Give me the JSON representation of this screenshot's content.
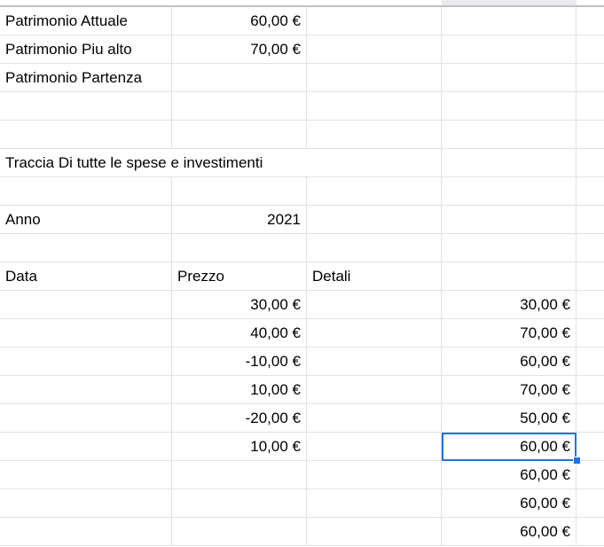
{
  "cells": {
    "patrimonio_attuale_label": "Patrimonio Attuale",
    "patrimonio_attuale_value": "60,00 €",
    "patrimonio_piu_alto_label": "Patrimonio Piu alto",
    "patrimonio_piu_alto_value": "70,00 €",
    "patrimonio_partenza_label": "Patrimonio Partenza",
    "traccia_title": "Traccia Di tutte le spese e investimenti",
    "anno_label": "Anno",
    "anno_value": "2021",
    "header_data": "Data",
    "header_prezzo": "Prezzo",
    "header_detali": "Detali"
  },
  "prezzo": [
    "30,00 €",
    "40,00 €",
    "-10,00 €",
    "10,00 €",
    "-20,00 €",
    "10,00 €"
  ],
  "running_total": [
    "30,00 €",
    "70,00 €",
    "60,00 €",
    "70,00 €",
    "50,00 €",
    "60,00 €",
    "60,00 €",
    "60,00 €",
    "60,00 €"
  ],
  "colors": {
    "selection": "#1a73e8",
    "gridline": "#e2e2e2"
  }
}
